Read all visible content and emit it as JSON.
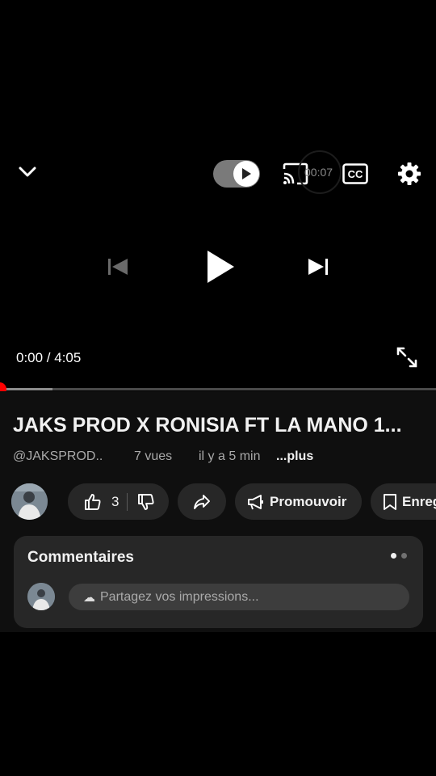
{
  "player": {
    "timer_badge": "00:07",
    "current_time": "0:00",
    "duration": "4:05",
    "time_display": "0:00 / 4:05",
    "progress_played": 0.0,
    "progress_buffered": 0.12,
    "autoplay_on": true
  },
  "video": {
    "title": "JAKS PROD X RONISIA FT LA MANO 1...",
    "channel": "@JAKSPROD..",
    "views": "7 vues",
    "age": "il y a 5 min",
    "more": "...plus"
  },
  "actions": {
    "like_count": "3",
    "promote_label": "Promouvoir",
    "save_label": "Enreg"
  },
  "comments": {
    "heading": "Commentaires",
    "placeholder": "Partagez vos impressions..."
  },
  "colors": {
    "accent": "#ff0000",
    "background": "#000000",
    "panel": "#0f0f0f",
    "chip": "#272727"
  },
  "icons": {
    "collapse": "chevron-down-icon",
    "autoplay": "autoplay-toggle",
    "cast": "cast-icon",
    "captions": "cc-icon",
    "settings": "gear-icon",
    "previous": "skip-previous-icon",
    "play": "play-icon",
    "next": "skip-next-icon",
    "fullscreen": "fullscreen-icon",
    "like": "thumbs-up-icon",
    "dislike": "thumbs-down-icon",
    "share": "share-icon",
    "promote": "megaphone-icon",
    "save": "bookmark-icon"
  }
}
